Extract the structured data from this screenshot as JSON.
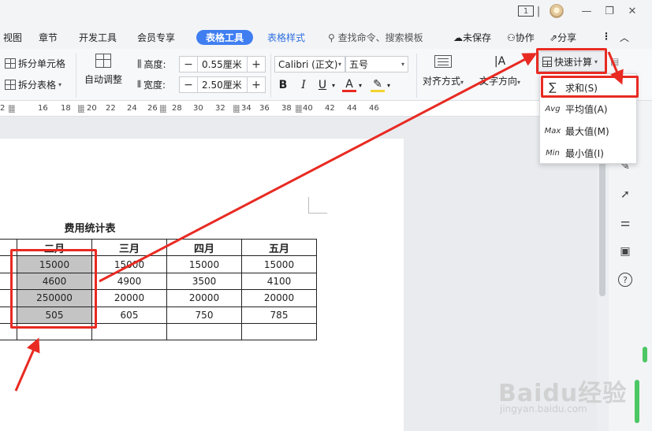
{
  "titlebar": {
    "page_indicator": "1"
  },
  "menu": {
    "items": [
      "视图",
      "章节",
      "开发工具",
      "会员专享"
    ],
    "active_tab": "表格工具",
    "style_tab": "表格样式",
    "search": "查找命令、搜索模板",
    "unsaved": "未保存",
    "collab": "协作",
    "share": "分享"
  },
  "ribbon": {
    "split_cells": "拆分单元格",
    "split_table": "拆分表格",
    "auto_adjust": "自动调整",
    "height_label": "高度:",
    "height_value": "0.55厘米",
    "width_label": "宽度:",
    "width_value": "2.50厘米",
    "font_name": "Calibri (正文)",
    "font_size": "五号",
    "align": "对齐方式",
    "text_direction": "文字方向",
    "quick_calc": "快速计算",
    "bold": "B",
    "italic": "I",
    "underline": "U",
    "font_color": "A"
  },
  "ruler": {
    "ticks": [
      "2",
      "16",
      "18",
      "20",
      "22",
      "24",
      "26",
      "28",
      "30",
      "32",
      "34",
      "36",
      "38",
      "40",
      "42",
      "44",
      "46"
    ]
  },
  "dropdown": {
    "items": [
      {
        "icon": "∑",
        "label": "求和(S)"
      },
      {
        "icon": "Avg",
        "label": "平均值(A)"
      },
      {
        "icon": "Max",
        "label": "最大值(M)"
      },
      {
        "icon": "Min",
        "label": "最小值(I)"
      }
    ]
  },
  "document": {
    "table_title": "费用统计表",
    "headers": [
      "",
      "二月",
      "三月",
      "四月",
      "五月"
    ],
    "rows": [
      [
        "",
        "15000",
        "15000",
        "15000",
        "15000"
      ],
      [
        "",
        "4600",
        "4900",
        "3500",
        "4100"
      ],
      [
        "",
        "250000",
        "20000",
        "20000",
        "20000"
      ],
      [
        "",
        "505",
        "605",
        "750",
        "785"
      ],
      [
        "",
        "",
        "",
        "",
        ""
      ]
    ]
  },
  "watermark": {
    "main": "Baidu经验",
    "sub": "jingyan.baidu.com"
  },
  "colors": {
    "accent": "#3f7ef1",
    "annotation": "#e82a22",
    "selected_cell": "#c4c4c4"
  }
}
